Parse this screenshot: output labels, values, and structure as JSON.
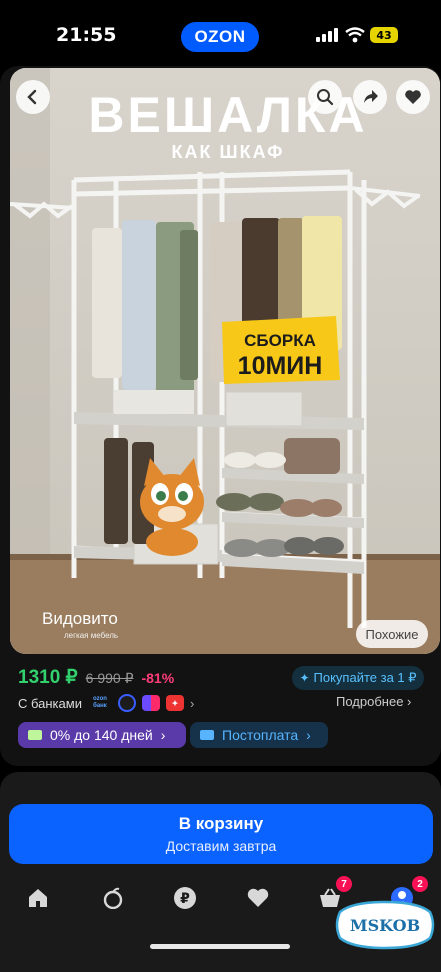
{
  "status": {
    "time": "21:55",
    "battery": "43",
    "brand_pill": "OZON"
  },
  "product_image": {
    "headline": "ВЕШАЛКА",
    "subheadline": "КАК ШКАФ",
    "promo_line1": "СБОРКА",
    "promo_line2": "10МИН",
    "brand_name": "Видовито",
    "brand_tagline": "легкая мебель",
    "similar_label": "Похожие"
  },
  "pricing": {
    "price": "1310 ₽",
    "old_price": "6 990 ₽",
    "discount": "-81%",
    "buy_for_label": "Покупайте за 1 ₽",
    "banks_label": "С банками",
    "ozon_bank_label": "ozon банк",
    "more_label": "Подробнее"
  },
  "chips": {
    "installment": "0% до 140 дней",
    "postpay": "Постоплата"
  },
  "cart": {
    "title": "В корзину",
    "subtitle": "Доставим завтра"
  },
  "tabbar": {
    "cart_count": "7",
    "profile_count": "2"
  },
  "watermark": {
    "text": "MSKOB"
  },
  "colors": {
    "accent": "#005bff",
    "price": "#33d06e",
    "discount": "#ff3c7a",
    "badge": "#f91155"
  }
}
